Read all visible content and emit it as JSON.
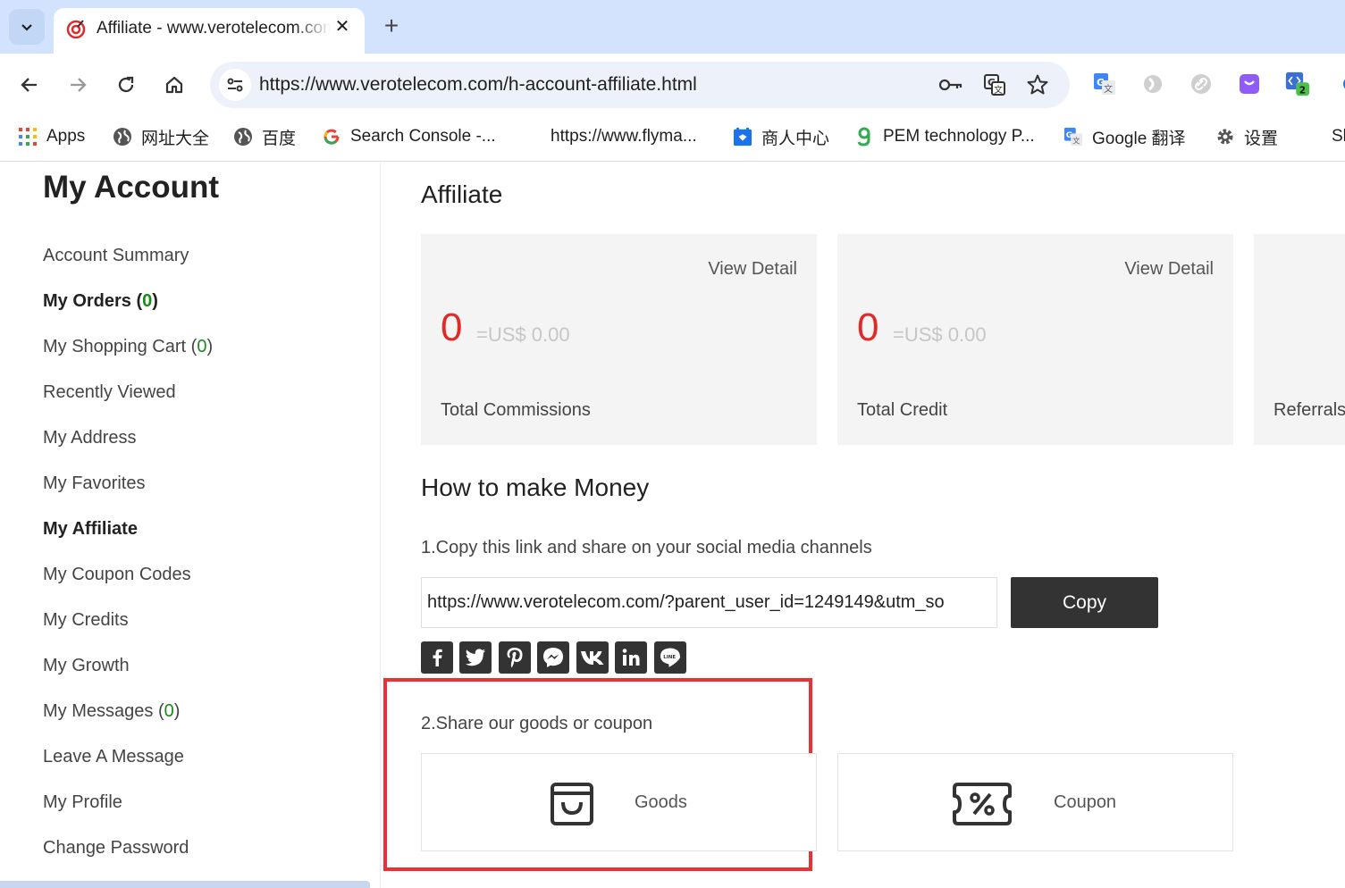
{
  "browser": {
    "tab_title": "Affiliate - www.verotelecom.com",
    "url": "https://www.verotelecom.com/h-account-affiliate.html",
    "extension_badge": "2",
    "bookmarks": [
      {
        "label": "Apps",
        "icon": "apps-grid-icon"
      },
      {
        "label": "网址大全",
        "icon": "globe-icon"
      },
      {
        "label": "百度",
        "icon": "globe-icon"
      },
      {
        "label": "Search Console -...",
        "icon": "google-icon"
      },
      {
        "label": "https://www.flyma...",
        "icon": "none"
      },
      {
        "label": "商人中心",
        "icon": "merchant-icon"
      },
      {
        "label": "PEM technology P...",
        "icon": "g-icon"
      },
      {
        "label": "Google 翻译",
        "icon": "translate-icon"
      },
      {
        "label": "设置",
        "icon": "gear-icon"
      },
      {
        "label": "Sl",
        "icon": "none"
      }
    ]
  },
  "sidebar": {
    "title": "My Account",
    "items": [
      {
        "label": "Account Summary"
      },
      {
        "label": "My Orders ",
        "count": "0",
        "bold": true
      },
      {
        "label": "My Shopping Cart ",
        "count": "0"
      },
      {
        "label": "Recently Viewed"
      },
      {
        "label": "My Address"
      },
      {
        "label": "My Favorites"
      },
      {
        "label": "My Affiliate",
        "bold": true
      },
      {
        "label": "My Coupon Codes"
      },
      {
        "label": "My Credits"
      },
      {
        "label": "My Growth"
      },
      {
        "label": "My Messages ",
        "count": "0"
      },
      {
        "label": "Leave A Message"
      },
      {
        "label": "My Profile"
      },
      {
        "label": "Change Password"
      }
    ]
  },
  "main": {
    "title": "Affiliate",
    "cards": [
      {
        "link": "View Detail",
        "value": "0",
        "money": "=US$ 0.00",
        "label": "Total Commissions"
      },
      {
        "link": "View Detail",
        "value": "0",
        "money": "=US$ 0.00",
        "label": "Total Credit"
      },
      {
        "label": "Referrals"
      }
    ],
    "how_title": "How to make Money",
    "step1": "1.Copy this link and share on your social media channels",
    "share_link": "https://www.verotelecom.com/?parent_user_id=1249149&utm_so",
    "copy_label": "Copy",
    "social": [
      "facebook",
      "twitter",
      "pinterest",
      "messenger",
      "vk",
      "linkedin",
      "line"
    ],
    "step2": "2.Share our goods or coupon",
    "goods_label": "Goods",
    "coupon_label": "Coupon"
  },
  "colors": {
    "accent_red": "#e02a2a",
    "highlight": "#ec3035",
    "button_dark": "#333333",
    "count_green": "#1a8a1a"
  }
}
